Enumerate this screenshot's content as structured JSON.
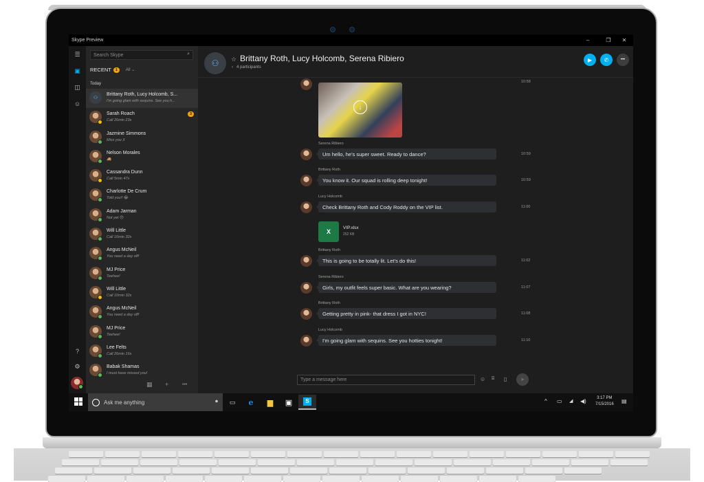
{
  "window": {
    "title": "Skype Preview",
    "controls": {
      "minimize": "–",
      "restore": "❐",
      "close": "✕"
    }
  },
  "rail": {
    "icons": [
      "hamburger-menu-icon",
      "recent-chats-icon",
      "contacts-icon",
      "bots-icon",
      "help-icon",
      "settings-icon"
    ],
    "help_label": "?",
    "settings_label": "⚙"
  },
  "sidebar": {
    "search_placeholder": "Search Skype",
    "recent_label": "RECENT",
    "recent_badge": "1",
    "filter_label": "All ⌄",
    "section_label": "Today",
    "contacts": [
      {
        "name": "Brittany Roth, Lucy Holcomb, S...",
        "message": "I'm going glam with sequins. See you h...",
        "group": true,
        "active": true,
        "status": ""
      },
      {
        "name": "Sarah Roach",
        "message": "Call 26min 23s",
        "status": "away",
        "unread": "3"
      },
      {
        "name": "Jazmine Simmons",
        "message": "Miss you X",
        "status": "online"
      },
      {
        "name": "Nelson Morales",
        "message": "🙈",
        "status": "online"
      },
      {
        "name": "Cassandra Dunn",
        "message": "Call 5min 47s",
        "status": "away"
      },
      {
        "name": "Charlotte De Crum",
        "message": "Told you!! 😂",
        "status": "online"
      },
      {
        "name": "Adam Jarman",
        "message": "Not yet 😞",
        "status": "online"
      },
      {
        "name": "Will Little",
        "message": "Call 10min 32s",
        "status": "online"
      },
      {
        "name": "Angus McNeil",
        "message": "You need a day off!",
        "status": "online"
      },
      {
        "name": "MJ Price",
        "message": "Teehee!",
        "status": "online"
      },
      {
        "name": "Will Little",
        "message": "Call 10min 32s",
        "status": "away"
      },
      {
        "name": "Angus McNeil",
        "message": "You need a day off!",
        "status": "online"
      },
      {
        "name": "MJ Price",
        "message": "Teehee!",
        "status": "online"
      },
      {
        "name": "Lee Felts",
        "message": "Call 26min 16s",
        "status": "online"
      },
      {
        "name": "Babak Shamas",
        "message": "I must have missed you!",
        "status": "online"
      }
    ],
    "footer": {
      "dialpad": "dialpad-icon",
      "add": "+",
      "more": "•••"
    }
  },
  "chat": {
    "title": "Brittany Roth, Lucy Holcomb, Serena Ribiero",
    "participants": "4 participants",
    "star": "☆",
    "chevron": "›",
    "buttons": {
      "video": "video-call",
      "call": "audio-call",
      "more": "•••"
    },
    "first_time": "10:58",
    "messages": [
      {
        "sender": "Serena Ribiero",
        "text": "Um hello, he's super sweet. Ready to dance?",
        "time": "10:59"
      },
      {
        "sender": "Brittany Roth",
        "text": "You know it. Our squad is rolling deep tonight!",
        "time": "10:59"
      },
      {
        "sender": "Lucy Holcomb",
        "text": "Check Brittany Roth and Cody Roddy on the VIP list.",
        "time": "11:00"
      },
      {
        "sender": "Brittany Roth",
        "text": "This is going to be totally lit. Let's do this!",
        "time": "11:02"
      },
      {
        "sender": "Serena Ribiero",
        "text": "Girls, my outfit feels super basic. What are you wearing?",
        "time": "11:07"
      },
      {
        "sender": "Brittany Roth",
        "text": "Getting pretty in pink- that dress I got in NYC!",
        "time": "11:08"
      },
      {
        "sender": "Lucy Holcomb",
        "text": "I'm going glam with sequins. See you hotties tonight!",
        "time": "11:10"
      }
    ],
    "attachment": {
      "name": "VIP.xlsx",
      "size": "252 KB",
      "icon": "X"
    },
    "compose_placeholder": "Type a message here",
    "compose_icons": {
      "emoji": "☺",
      "media": "🖼",
      "file": "▯",
      "send": "➤"
    }
  },
  "taskbar": {
    "cortana_placeholder": "Ask me anything",
    "mic": "🎤",
    "apps": [
      "task-view",
      "edge",
      "file-explorer",
      "store",
      "skype"
    ],
    "tray": {
      "chevron": "^",
      "battery": "▭",
      "wifi": "◢",
      "volume": "🔊",
      "notification": "🗨"
    },
    "time": "3:17 PM",
    "date": "7/15/2016"
  },
  "colors": {
    "accent_blue": "#00aff0",
    "presence_online": "#5cb85c",
    "presence_away": "#f2c200",
    "badge_orange": "#f0a30a",
    "excel_green": "#1d7a45"
  }
}
